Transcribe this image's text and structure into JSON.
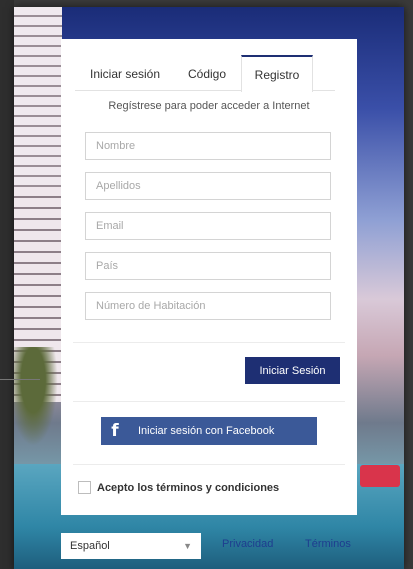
{
  "tabs": [
    {
      "label": "Iniciar sesión",
      "active": false
    },
    {
      "label": "Código",
      "active": false
    },
    {
      "label": "Registro",
      "active": true
    }
  ],
  "form": {
    "subtitle": "Regístrese para poder acceder a Internet",
    "fields": [
      {
        "placeholder": "Nombre",
        "value": ""
      },
      {
        "placeholder": "Apellidos",
        "value": ""
      },
      {
        "placeholder": "Email",
        "value": ""
      },
      {
        "placeholder": "País",
        "value": ""
      },
      {
        "placeholder": "Número de Habitación",
        "value": ""
      }
    ],
    "submit_label": "Iniciar Sesión"
  },
  "facebook": {
    "icon": "f",
    "label": "Iniciar sesión con Facebook"
  },
  "terms": {
    "label": "Acepto los términos y condiciones",
    "checked": false
  },
  "footer": {
    "language": "Español",
    "privacy_label": "Privacidad",
    "terms_label": "Términos"
  },
  "colors": {
    "primary": "#1e2f73",
    "facebook": "#3b5998",
    "link": "#1e3d8f"
  }
}
